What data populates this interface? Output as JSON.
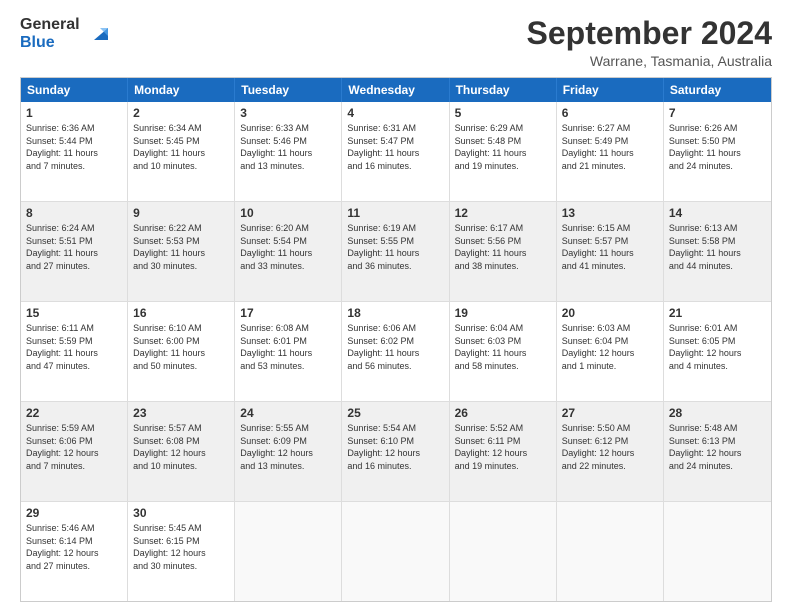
{
  "logo": {
    "line1": "General",
    "line2": "Blue"
  },
  "title": "September 2024",
  "subtitle": "Warrane, Tasmania, Australia",
  "headers": [
    "Sunday",
    "Monday",
    "Tuesday",
    "Wednesday",
    "Thursday",
    "Friday",
    "Saturday"
  ],
  "rows": [
    [
      {
        "day": "1",
        "text": "Sunrise: 6:36 AM\nSunset: 5:44 PM\nDaylight: 11 hours\nand 7 minutes."
      },
      {
        "day": "2",
        "text": "Sunrise: 6:34 AM\nSunset: 5:45 PM\nDaylight: 11 hours\nand 10 minutes."
      },
      {
        "day": "3",
        "text": "Sunrise: 6:33 AM\nSunset: 5:46 PM\nDaylight: 11 hours\nand 13 minutes."
      },
      {
        "day": "4",
        "text": "Sunrise: 6:31 AM\nSunset: 5:47 PM\nDaylight: 11 hours\nand 16 minutes."
      },
      {
        "day": "5",
        "text": "Sunrise: 6:29 AM\nSunset: 5:48 PM\nDaylight: 11 hours\nand 19 minutes."
      },
      {
        "day": "6",
        "text": "Sunrise: 6:27 AM\nSunset: 5:49 PM\nDaylight: 11 hours\nand 21 minutes."
      },
      {
        "day": "7",
        "text": "Sunrise: 6:26 AM\nSunset: 5:50 PM\nDaylight: 11 hours\nand 24 minutes."
      }
    ],
    [
      {
        "day": "8",
        "text": "Sunrise: 6:24 AM\nSunset: 5:51 PM\nDaylight: 11 hours\nand 27 minutes."
      },
      {
        "day": "9",
        "text": "Sunrise: 6:22 AM\nSunset: 5:53 PM\nDaylight: 11 hours\nand 30 minutes."
      },
      {
        "day": "10",
        "text": "Sunrise: 6:20 AM\nSunset: 5:54 PM\nDaylight: 11 hours\nand 33 minutes."
      },
      {
        "day": "11",
        "text": "Sunrise: 6:19 AM\nSunset: 5:55 PM\nDaylight: 11 hours\nand 36 minutes."
      },
      {
        "day": "12",
        "text": "Sunrise: 6:17 AM\nSunset: 5:56 PM\nDaylight: 11 hours\nand 38 minutes."
      },
      {
        "day": "13",
        "text": "Sunrise: 6:15 AM\nSunset: 5:57 PM\nDaylight: 11 hours\nand 41 minutes."
      },
      {
        "day": "14",
        "text": "Sunrise: 6:13 AM\nSunset: 5:58 PM\nDaylight: 11 hours\nand 44 minutes."
      }
    ],
    [
      {
        "day": "15",
        "text": "Sunrise: 6:11 AM\nSunset: 5:59 PM\nDaylight: 11 hours\nand 47 minutes."
      },
      {
        "day": "16",
        "text": "Sunrise: 6:10 AM\nSunset: 6:00 PM\nDaylight: 11 hours\nand 50 minutes."
      },
      {
        "day": "17",
        "text": "Sunrise: 6:08 AM\nSunset: 6:01 PM\nDaylight: 11 hours\nand 53 minutes."
      },
      {
        "day": "18",
        "text": "Sunrise: 6:06 AM\nSunset: 6:02 PM\nDaylight: 11 hours\nand 56 minutes."
      },
      {
        "day": "19",
        "text": "Sunrise: 6:04 AM\nSunset: 6:03 PM\nDaylight: 11 hours\nand 58 minutes."
      },
      {
        "day": "20",
        "text": "Sunrise: 6:03 AM\nSunset: 6:04 PM\nDaylight: 12 hours\nand 1 minute."
      },
      {
        "day": "21",
        "text": "Sunrise: 6:01 AM\nSunset: 6:05 PM\nDaylight: 12 hours\nand 4 minutes."
      }
    ],
    [
      {
        "day": "22",
        "text": "Sunrise: 5:59 AM\nSunset: 6:06 PM\nDaylight: 12 hours\nand 7 minutes."
      },
      {
        "day": "23",
        "text": "Sunrise: 5:57 AM\nSunset: 6:08 PM\nDaylight: 12 hours\nand 10 minutes."
      },
      {
        "day": "24",
        "text": "Sunrise: 5:55 AM\nSunset: 6:09 PM\nDaylight: 12 hours\nand 13 minutes."
      },
      {
        "day": "25",
        "text": "Sunrise: 5:54 AM\nSunset: 6:10 PM\nDaylight: 12 hours\nand 16 minutes."
      },
      {
        "day": "26",
        "text": "Sunrise: 5:52 AM\nSunset: 6:11 PM\nDaylight: 12 hours\nand 19 minutes."
      },
      {
        "day": "27",
        "text": "Sunrise: 5:50 AM\nSunset: 6:12 PM\nDaylight: 12 hours\nand 22 minutes."
      },
      {
        "day": "28",
        "text": "Sunrise: 5:48 AM\nSunset: 6:13 PM\nDaylight: 12 hours\nand 24 minutes."
      }
    ],
    [
      {
        "day": "29",
        "text": "Sunrise: 5:46 AM\nSunset: 6:14 PM\nDaylight: 12 hours\nand 27 minutes."
      },
      {
        "day": "30",
        "text": "Sunrise: 5:45 AM\nSunset: 6:15 PM\nDaylight: 12 hours\nand 30 minutes."
      },
      {
        "day": "",
        "text": ""
      },
      {
        "day": "",
        "text": ""
      },
      {
        "day": "",
        "text": ""
      },
      {
        "day": "",
        "text": ""
      },
      {
        "day": "",
        "text": ""
      }
    ]
  ],
  "shadedRows": [
    1,
    3
  ],
  "colors": {
    "headerBg": "#1a6bbf",
    "shadedBg": "#f0f0f0",
    "emptyBg": "#f9f9f9"
  }
}
